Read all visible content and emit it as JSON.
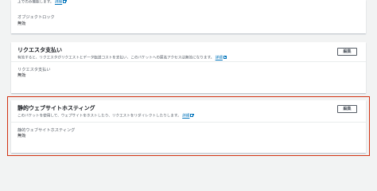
{
  "top_panel": {
    "description": "上でのみ機能します。",
    "info_link": "詳細",
    "object_lock_label": "オブジェクトロック",
    "object_lock_value": "無効"
  },
  "requester_pays": {
    "title": "リクエスタ支払い",
    "description": "有効すると、リクエスタがリクエストとデータ転送コストを支払い、このバケットへの匿名アクセスは無効になります。",
    "info_link": "詳細",
    "edit_label": "編集",
    "field_label": "リクエスタ支払い",
    "field_value": "無効"
  },
  "static_hosting": {
    "title": "静的ウェブサイトホスティング",
    "description": "このバケットを使用して、ウェブサイトをホストしたり、リクエストをリダイレクトしたりします。",
    "info_link": "詳細",
    "edit_label": "編集",
    "field_label": "静的ウェブサイトホスティング",
    "field_value": "無効"
  },
  "colors": {
    "highlight": "#d13212",
    "link": "#0073bb",
    "background": "#f2f3f3"
  }
}
